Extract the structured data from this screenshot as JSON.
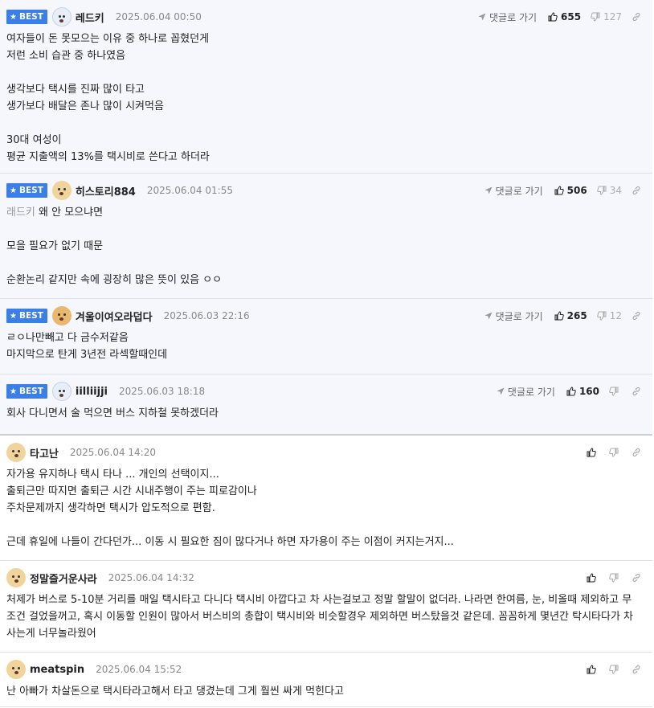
{
  "ui": {
    "best_label": "BEST",
    "goto_label": "댓글로 가기"
  },
  "comments": [
    {
      "best": true,
      "avatar": "polar-bear-avatar",
      "nickname": "레드키",
      "date": "2025.06.04 00:50",
      "likes": "655",
      "dislikes": "127",
      "body": "여자들이 돈 못모으는 이유 중 하나로 꼽혔던게\n저런 소비 습관 중 하나였음\n\n생각보다 택시를 진짜 많이 타고\n생가보다 배달은 존나 많이 시켜먹음\n\n30대 여성이\n평균 지출액의 13%를 택시비로 쓴다고 하더라"
    },
    {
      "best": true,
      "avatar": "puppy-avatar",
      "nickname": "히스토리884",
      "date": "2025.06.04 01:55",
      "likes": "506",
      "dislikes": "34",
      "mention": "래드키",
      "body": " 왜 안 모으냐면\n\n모을 필요가 없기 때문\n\n순환논리 같지만 속에 굉장히 많은 뜻이 있음 ㅇㅇ"
    },
    {
      "best": true,
      "avatar": "red-puppy-avatar",
      "nickname": "겨울이여오라덥다",
      "date": "2025.06.03 22:16",
      "likes": "265",
      "dislikes": "12",
      "body": "ㄹㅇ나만빼고 다 금수저같음\n마지막으로 탄게 3년전 라섹할때인데"
    },
    {
      "best": true,
      "avatar": "polar-bear-avatar",
      "nickname": "iilliijji",
      "date": "2025.06.03 18:18",
      "likes": "160",
      "dislikes": "",
      "body": "회사 다니면서 술 먹으면 버스 지하철 못하겠더라"
    },
    {
      "best": false,
      "avatar": "puppy-avatar",
      "nickname": "타고난",
      "date": "2025.06.04 14:20",
      "likes": "",
      "dislikes": "",
      "body": "자가용 유지하나 택시 타나 ... 개인의 선택이지...\n출퇴근만 따지면 출퇴근 시간 시내주행이 주는 피로감이나\n주차문제까지 생각하면 택시가 압도적으로 편함.\n\n근데 휴일에 나들이 간다던가... 이동 시 필요한 짐이 많다거나 하면 자가용이 주는 이점이 커지는거지..."
    },
    {
      "best": false,
      "avatar": "puppy-avatar",
      "nickname": "정말즐거운사라",
      "date": "2025.06.04 14:32",
      "likes": "",
      "dislikes": "",
      "body": "처제가 버스로 5-10분 거리를 매일 택시타고 다니다 택시비 아깝다고 차 사는걸보고 정말 할말이 없더라. 나라면 한여름, 눈, 비올때 제외하고 무조건 걸었을꺼고, 혹시 이동할 인원이 많아서 버스비의 총합이 택시비와 비슷할경우 제외하면 버스탔을것 같은데. 꼼꼼하게 몇년간 탁시타다가 차사는게 너무놀라웠어"
    },
    {
      "best": false,
      "avatar": "puppy-avatar",
      "nickname": "meatspin",
      "date": "2025.06.04 15:52",
      "likes": "",
      "dislikes": "",
      "body": "난 아빠가 차살돈으로 택시타라고해서 타고 댕겼는데 그게 훨씬 싸게 먹힌다고"
    }
  ]
}
